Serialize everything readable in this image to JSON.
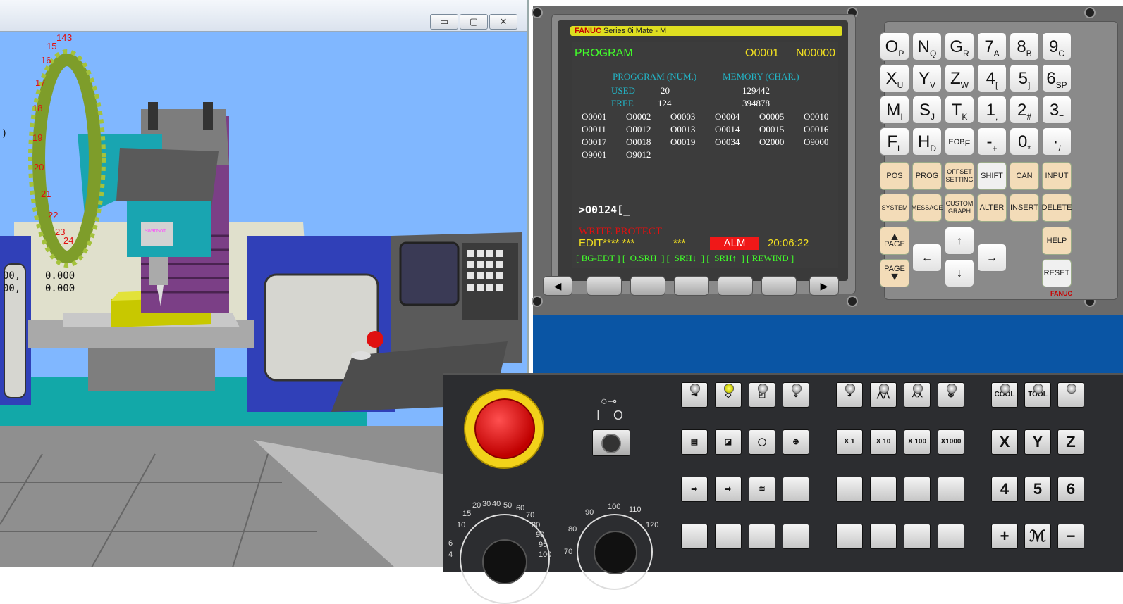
{
  "window3d": {
    "controls": {
      "minimize": "▭",
      "maximize": "▢",
      "close": "✕"
    },
    "coords": [
      {
        "left": "00,",
        "right": "0.000"
      },
      {
        "left": "00,",
        "right": "0.000"
      }
    ],
    "tool_magazine_numbers": [
      "14",
      "3",
      "15",
      "16",
      "17",
      "18",
      "19",
      "20",
      "21",
      "22",
      "23",
      "24",
      ")"
    ],
    "machine_logo": "SwanSoft"
  },
  "cnc": {
    "header": {
      "brand": "FANUC",
      "series": "Series 0i Mate - M"
    },
    "screen": {
      "mode_title": "PROGRAM",
      "program_no": "O0001",
      "seq_no": "N00000",
      "col_headers": {
        "prog": "PROGGRAM (NUM.)",
        "mem": "MEMORY (CHAR.)"
      },
      "used": {
        "label": "USED",
        "num": "20",
        "mem": "129442"
      },
      "free": {
        "label": "FREE",
        "num": "124",
        "mem": "394878"
      },
      "programs": [
        [
          "O0001",
          "O0002",
          "O0003",
          "O0004",
          "O0005",
          "O0010"
        ],
        [
          "O0011",
          "O0012",
          "O0013",
          "O0014",
          "O0015",
          "O0016"
        ],
        [
          "O0017",
          "O0018",
          "O0019",
          "O0034",
          "O2000",
          "O9000"
        ],
        [
          "O9001",
          "O9012",
          "",
          "",
          "",
          ""
        ]
      ],
      "input_line": ">O0124[_",
      "warning": "WRITE PROTECT",
      "status_mode": "EDIT**** ***",
      "status_stars": "***",
      "alarm": "ALM",
      "clock": "20:06:22",
      "softkeys": "[ BG-EDT ] [  O.SRH  ] [  SRH↓  ] [  SRH↑  ] [ REWIND ]"
    },
    "softkey_arrows": {
      "left": "◀",
      "right": "▶"
    },
    "address_keys": [
      {
        "main": "O",
        "sub": "P"
      },
      {
        "main": "N",
        "sub": "Q"
      },
      {
        "main": "G",
        "sub": "R"
      },
      {
        "main": "7",
        "sub": "A"
      },
      {
        "main": "8",
        "sub": "B"
      },
      {
        "main": "9",
        "sub": "C"
      },
      {
        "main": "X",
        "sub": "U"
      },
      {
        "main": "Y",
        "sub": "V"
      },
      {
        "main": "Z",
        "sub": "W"
      },
      {
        "main": "4",
        "sub": "["
      },
      {
        "main": "5",
        "sub": "]"
      },
      {
        "main": "6",
        "sub": "SP"
      },
      {
        "main": "M",
        "sub": "I"
      },
      {
        "main": "S",
        "sub": "J"
      },
      {
        "main": "T",
        "sub": "K"
      },
      {
        "main": "1",
        "sub": ","
      },
      {
        "main": "2",
        "sub": "#"
      },
      {
        "main": "3",
        "sub": "="
      },
      {
        "main": "F",
        "sub": "L"
      },
      {
        "main": "H",
        "sub": "D"
      },
      {
        "main": "EOB",
        "sub": "E"
      },
      {
        "main": "-",
        "sub": "+"
      },
      {
        "main": "0",
        "sub": "*"
      },
      {
        "main": "·",
        "sub": "/"
      }
    ],
    "func_keys_row1": [
      "POS",
      "PROG",
      "OFFSET SETTING",
      "SHIFT",
      "CAN",
      "INPUT"
    ],
    "func_keys_row2": [
      "SYSTEM",
      "MESSAGE",
      "CUSTOM GRAPH",
      "ALTER",
      "INSERT",
      "DELETE"
    ],
    "page_up": "PAGE",
    "page_down": "PAGE",
    "help": "HELP",
    "reset": "RESET",
    "brand_small": "FANUC"
  },
  "operator": {
    "key_symbol": "○⊸",
    "switch_on": "I",
    "switch_off": "O",
    "jog_step": [
      "X 1",
      "X 10",
      "X 100",
      "X1000"
    ],
    "cool": "COOL",
    "tool": "TOOL",
    "axis": [
      "X",
      "Y",
      "Z"
    ],
    "axis2": [
      "4",
      "5",
      "6"
    ],
    "plus": "+",
    "rapid": "ℳ",
    "minus": "−",
    "feed_dial": [
      "20",
      "30",
      "40",
      "50",
      "60",
      "15",
      "70",
      "10",
      "80",
      "90",
      "6",
      "95",
      "4",
      "100"
    ],
    "spindle_dial": [
      "90",
      "100",
      "110",
      "120",
      "80",
      "70"
    ]
  }
}
